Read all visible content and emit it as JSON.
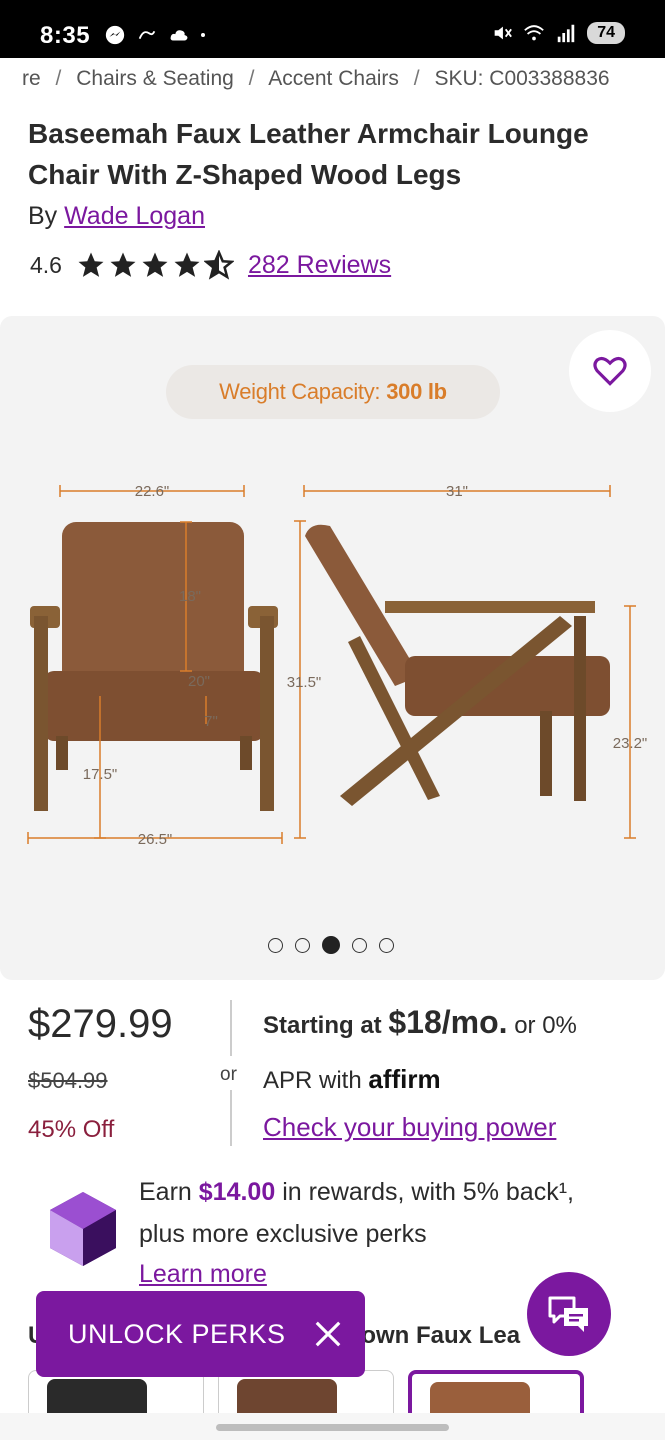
{
  "status_bar": {
    "time": "8:35",
    "battery": "74",
    "icons_left": [
      "messenger-icon",
      "link-icon",
      "cloud-icon",
      "dot-icon"
    ],
    "icons_right": [
      "mute-icon",
      "wifi-6e-icon",
      "signal-icon",
      "battery-icon"
    ]
  },
  "breadcrumb": {
    "items": [
      "re",
      "Chairs & Seating",
      "Accent Chairs",
      "SKU: C003388836"
    ],
    "separator": "/"
  },
  "product": {
    "title": "Baseemah Faux Leather Armchair Lounge Chair With Z-Shaped Wood Legs",
    "by_prefix": "By",
    "brand": "Wade Logan",
    "rating_value": "4.6",
    "rating_stars": 4.6,
    "reviews_label": "282 Reviews"
  },
  "gallery": {
    "weight_label": "Weight Capacity:",
    "weight_value": "300 lb",
    "dimensions": {
      "front_width": "22.6\"",
      "back_height": "18\"",
      "seat_depth": "20\"",
      "cushion": "7\"",
      "seat_height": "17.5\"",
      "overall_width": "26.5\"",
      "overall_height": "31.5\"",
      "side_depth": "31\"",
      "arm_height": "23.2\""
    },
    "dots_count": 5,
    "active_dot": 3
  },
  "pricing": {
    "price": "$279.99",
    "was_price": "$504.99",
    "discount": "45% Off",
    "or_label": "or",
    "financing_prefix": "Starting at",
    "monthly": "$18/mo.",
    "financing_suffix": "or 0%",
    "apr_prefix": "APR with",
    "affirm": "affirm",
    "buying_power_link": "Check your buying power"
  },
  "rewards": {
    "line1_prefix": "Earn",
    "amount": "$14.00",
    "line1_suffix": "in rewards, with 5% back¹,",
    "line2": "plus more exclusive perks",
    "learn_more": "Learn more"
  },
  "color_section": {
    "label_visible": "U",
    "label_visible_2": "rown Faux Lea"
  },
  "unlock_perks": {
    "label": "UNLOCK PERKS"
  },
  "colors": {
    "accent": "#7b189f",
    "discount": "#8a1f3d",
    "dimension_orange": "#d97d2a",
    "chair_leather": "#8b5a3a"
  }
}
